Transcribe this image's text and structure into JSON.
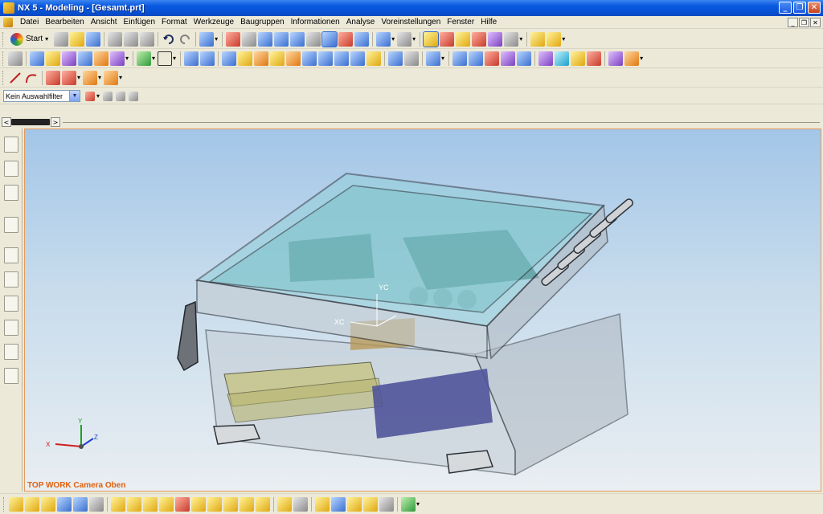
{
  "window": {
    "title": "NX 5 - Modeling - [Gesamt.prt]",
    "controls": [
      "_",
      "❐",
      "✕"
    ]
  },
  "menubar": {
    "items": [
      "Datei",
      "Bearbeiten",
      "Ansicht",
      "Einfügen",
      "Format",
      "Werkzeuge",
      "Baugruppen",
      "Informationen",
      "Analyse",
      "Voreinstellungen",
      "Fenster",
      "Hilfe"
    ],
    "mdi_controls": [
      "_",
      "❐",
      "✕"
    ]
  },
  "toolbar_standard": {
    "start_label": "Start",
    "icons": [
      "new-icon",
      "open-icon",
      "save-icon",
      "cut-icon",
      "copy-icon",
      "paste-icon",
      "undo-icon",
      "redo-icon",
      "select-icon",
      "fit-icon",
      "zoom-window-icon",
      "zoom-icon",
      "rotate-icon",
      "pan-icon",
      "shaded-icon",
      "layer-icon",
      "view-orient-icon",
      "render-style-icon",
      "wcs-icon",
      "point-icon",
      "snap-icon",
      "curve-icon",
      "measure-icon",
      "sketch-icon"
    ]
  },
  "toolbar_features": {
    "icons": [
      "assembly-icon",
      "extrude-icon",
      "revolve-icon",
      "sweep-icon",
      "datum-plane-icon",
      "datum-axis-icon",
      "sketch-icon",
      "box-icon",
      "cylinder-icon",
      "cone-icon",
      "sphere-icon",
      "hole-icon",
      "boss-icon",
      "pocket-icon",
      "pad-icon",
      "slot-icon",
      "groove-icon",
      "thread-icon",
      "blend-icon",
      "chamfer-icon",
      "shell-icon",
      "draft-icon",
      "offset-icon",
      "trim-icon",
      "unite-icon",
      "subtract-icon",
      "intersect-icon",
      "pattern-icon",
      "mirror-icon",
      "sew-icon",
      "thicken-icon",
      "face-icon",
      "color-icon",
      "paint-icon"
    ]
  },
  "toolbar_curves": {
    "icons": [
      "line-icon",
      "arc-icon",
      "spline-icon",
      "curve-offset-icon",
      "curve-project-icon",
      "curve-bridge-icon"
    ]
  },
  "filter": {
    "value": "Kein Auswahlfilter"
  },
  "viewport": {
    "label": "TOP WORK Camera Oben",
    "wcs_labels": {
      "xc": "XC",
      "yc": "YC"
    },
    "triad_labels": {
      "x": "X",
      "y": "Y",
      "z": "Z"
    }
  },
  "resource_bar": {
    "icons": [
      "assembly-navigator-icon",
      "part-navigator-icon",
      "constraint-navigator-icon",
      "web-browser-icon",
      "history-icon",
      "reuse-library-icon",
      "visualization-icon",
      "role-icon",
      "system-materials-icon",
      "image-icon"
    ]
  },
  "bottom_toolbar": {
    "icons": [
      "assembly-add-icon",
      "component-icon",
      "mate-icon",
      "reposition-icon",
      "explode-icon",
      "array-icon",
      "replace-icon",
      "wave-icon",
      "sequence-icon",
      "clearance-icon",
      "interference-icon",
      "route-icon",
      "pipe-icon",
      "weld-icon",
      "harness-icon",
      "electrical-icon",
      "clone-icon",
      "link-icon",
      "load-icon",
      "save-as-icon",
      "product-icon",
      "feature-icon",
      "drawing-icon",
      "motion-icon",
      "analysis-icon",
      "report-icon",
      "help-icon"
    ]
  }
}
